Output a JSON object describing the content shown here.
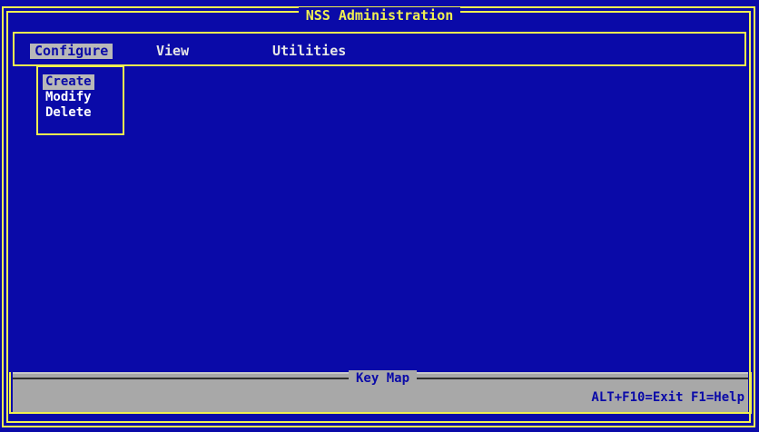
{
  "window": {
    "title": "NSS Administration"
  },
  "menu": {
    "items": [
      {
        "label": "Configure",
        "active": true
      },
      {
        "label": "View",
        "active": false
      },
      {
        "label": "Utilities",
        "active": false
      }
    ]
  },
  "dropdown": {
    "items": [
      {
        "label": "Create",
        "selected": true
      },
      {
        "label": "Modify",
        "selected": false
      },
      {
        "label": "Delete",
        "selected": false
      }
    ]
  },
  "keymap": {
    "title": "Key Map",
    "keys": "ALT+F10=Exit F1=Help"
  },
  "colors": {
    "background": "#0A0AA8",
    "border": "#F0F050",
    "highlight": "#B8B8B8",
    "text": "#FFFFFF"
  }
}
